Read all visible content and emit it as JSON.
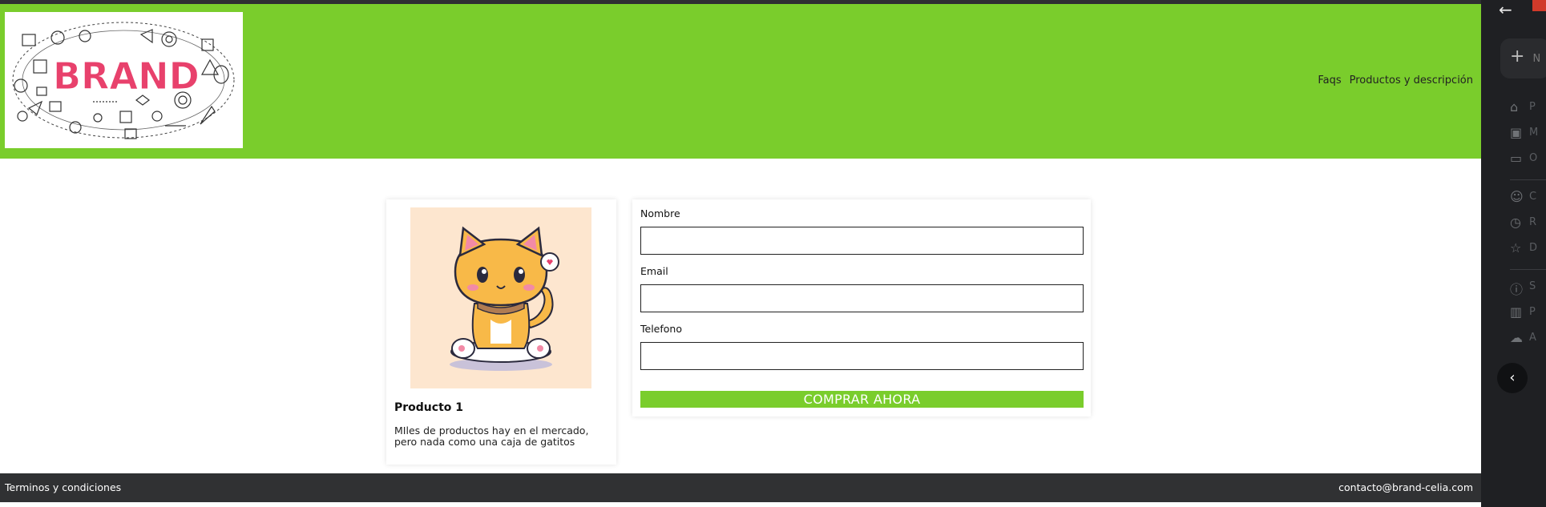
{
  "header": {
    "logo_text": "BRAND",
    "nav": [
      "Faqs",
      "Productos y descripción"
    ]
  },
  "product": {
    "title": "Producto 1",
    "description": "MIles de productos hay en el mercado, pero nada como una caja de gatitos"
  },
  "form": {
    "name_label": "Nombre",
    "email_label": "Email",
    "phone_label": "Telefono",
    "name_value": "",
    "email_value": "",
    "phone_value": "",
    "submit_label": "COMPRAR AHORA"
  },
  "footer": {
    "terms": "Terminos y condiciones",
    "contact": "contacto@brand-celia.com"
  },
  "colors": {
    "accent": "#7acd2c",
    "footer": "#303133",
    "logo_text": "#e8416c"
  },
  "side_panel": {
    "icons": [
      "back-arrow-icon",
      "plus-icon",
      "home-icon",
      "lock-icon",
      "devices-icon",
      "people-icon",
      "clock-icon",
      "star-icon",
      "info-icon",
      "trash-icon",
      "cloud-icon",
      "chevron-left-icon"
    ],
    "row_snippets": [
      "N",
      "P",
      "M",
      "O",
      "C",
      "R",
      "D",
      "S",
      "P",
      "A"
    ]
  }
}
